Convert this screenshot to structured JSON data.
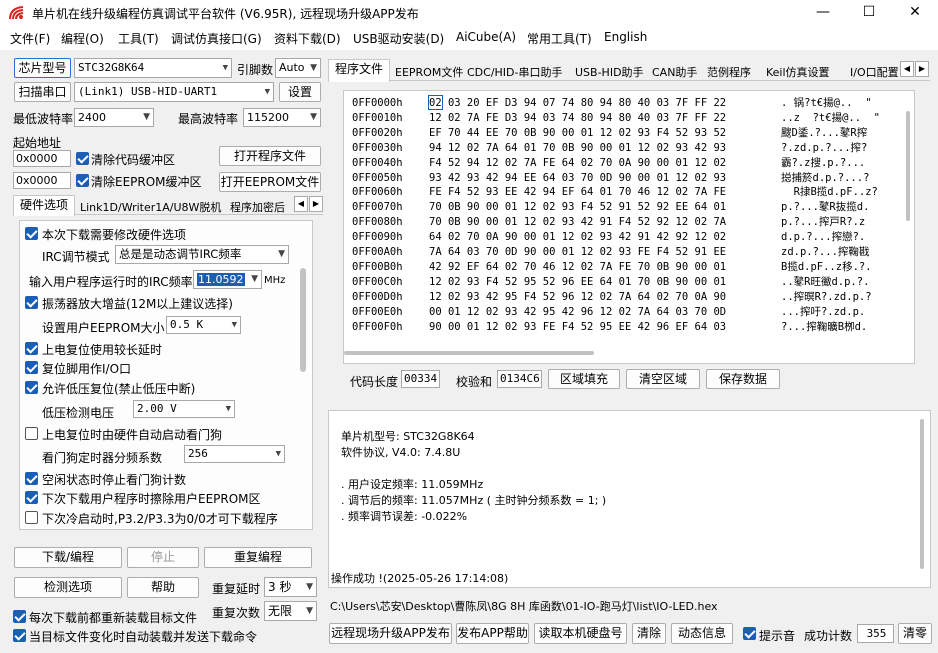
{
  "title": "单片机在线升级编程仿真调试平台软件 (V6.95R), 远程现场升级APP发布",
  "window_controls": {
    "min": "—",
    "max": "☐",
    "close": "✕"
  },
  "menu": [
    "文件(F)",
    "编程(O)",
    "工具(T)",
    "调试仿真接口(G)",
    "资料下载(D)",
    "USB驱动安装(D)",
    "AiCube(A)",
    "常用工具(T)",
    "English"
  ],
  "left": {
    "chip_btn": "芯片型号",
    "chip_value": "STC32G8K64",
    "pins_label": "引脚数",
    "pins_value": "Auto",
    "scan_btn": "扫描串口",
    "port_value": "(Link1) USB-HID-UART1",
    "settings_btn": "设置",
    "min_baud_label": "最低波特率",
    "min_baud": "2400",
    "max_baud_label": "最高波特率",
    "max_baud": "115200",
    "start_addr_label": "起始地址",
    "addr1": "0x0000",
    "clear_code": "清除代码缓冲区",
    "open_prog_btn": "打开程序文件",
    "addr2": "0x0000",
    "clear_eeprom": "清除EEPROM缓冲区",
    "open_eeprom_btn": "打开EEPROM文件",
    "tabs": [
      "硬件选项",
      "Link1D/Writer1A/U8W脱机",
      "程序加密后"
    ],
    "opt_modify": "本次下载需要修改硬件选项",
    "irc_mode_label": "IRC调节模式",
    "irc_mode": "总是是动态调节IRC频率",
    "irc_freq_label": "输入用户程序运行时的IRC频率",
    "irc_freq": "11.0592",
    "mhz": "MHz",
    "osc": "振荡器放大增益(12M以上建议选择)",
    "eeprom_size_label": "设置用户EEPROM大小",
    "eeprom_size": "0.5 K",
    "por_delay": "上电复位使用较长延时",
    "reset_io": "复位脚用作I/O口",
    "lvr": "允许低压复位(禁止低压中断)",
    "lv_label": "低压检测电压",
    "lv_value": "2.00 V",
    "wdt": "上电复位时由硬件自动启动看门狗",
    "wdt_div_label": "看门狗定时器分频系数",
    "wdt_div": "256",
    "idle_wdt": "空闲状态时停止看门狗计数",
    "erase_eeprom": "下次下载用户程序时擦除用户EEPROM区",
    "p32": "下次冷启动时,P3.2/P3.3为0/0才可下载程序",
    "download_btn": "下载/编程",
    "stop_btn": "停止",
    "reprogram_btn": "重复编程",
    "detect_btn": "检测选项",
    "help_btn": "帮助",
    "repeat_delay_label": "重复延时",
    "repeat_delay": "3 秒",
    "reload_cb": "每次下载前都重新装载目标文件",
    "repeat_count_label": "重复次数",
    "repeat_count": "无限",
    "autoload_cb": "当目标文件变化时自动装载并发送下载命令"
  },
  "right": {
    "tabs": [
      "程序文件",
      "EEPROM文件",
      "CDC/HID-串口助手",
      "USB-HID助手",
      "CAN助手",
      "范例程序",
      "Keil仿真设置",
      "I/O口配置"
    ],
    "hex_addrs": [
      "0FF0000h",
      "0FF0010h",
      "0FF0020h",
      "0FF0030h",
      "0FF0040h",
      "0FF0050h",
      "0FF0060h",
      "0FF0070h",
      "0FF0080h",
      "0FF0090h",
      "0FF00A0h",
      "0FF00B0h",
      "0FF00C0h",
      "0FF00D0h",
      "0FF00E0h",
      "0FF00F0h"
    ],
    "hex_bytes": [
      "02 03 20 EF D3 94 07 74 80 94 80 40 03 7F FF 22",
      "12 02 7A FE D3 94 03 74 80 94 80 40 03 7F FF 22",
      "EF 70 44 EE 70 0B 90 00 01 12 02 93 F4 52 93 52",
      "94 12 02 7A 64 01 70 0B 90 00 01 12 02 93 42 93",
      "F4 52 94 12 02 7A FE 64 02 70 0A 90 00 01 12 02",
      "93 42 93 42 94 EE 64 03 70 0D 90 00 01 12 02 93",
      "FE F4 52 93 EE 42 94 EF 64 01 70 46 12 02 7A FE",
      "70 0B 90 00 01 12 02 93 F4 52 91 52 92 EE 64 01",
      "70 0B 90 00 01 12 02 93 42 91 F4 52 92 12 02 7A",
      "64 02 70 0A 90 00 01 12 02 93 42 91 42 92 12 02",
      "7A 64 03 70 0D 90 00 01 12 02 93 FE F4 52 91 EE",
      "42 92 EF 64 02 70 46 12 02 7A FE 70 0B 90 00 01",
      "12 02 93 F4 52 95 52 96 EE 64 01 70 0B 90 00 01",
      "12 02 93 42 95 F4 52 96 12 02 7A 64 02 70 0A 90",
      "00 01 12 02 93 42 95 42 96 12 02 7A 64 03 70 0D",
      "90 00 01 12 02 93 FE F4 52 95 EE 42 96 EF 64 03"
    ],
    "hex_ascii": [
      ". 锅?t€揚@..  \"",
      "..z  ?t€揚@..  \"",
      "颼D鋈.?...鼕R搾",
      "?.zd.p.?...搾?",
      "霸?.z搜.p.?...",
      "搃捕箊d.p.?...?",
      "  R捸B揽d.pF..z?",
      "p.?...鼕R抜揽d.",
      "p.?...搾戸R?.z",
      "d.p.?...搾戀?.",
      "zd.p.?...搾鞠戡",
      "B揽d.pF..z移.?.",
      "..鼕R旺鰴d.p.?.",
      "..搾暝R?.zd.p.?",
      "...搾吁?.zd.p.",
      "?...搾鞠曠B栁d."
    ],
    "code_len_label": "代码长度",
    "code_len": "00334",
    "checksum_label": "校验和",
    "checksum": "0134C6",
    "fill_btn": "区域填充",
    "clear_area_btn": "清空区域",
    "save_btn": "保存数据",
    "log": [
      "单片机型号: STC32G8K64",
      "软件协议, V4.0: 7.4.8U",
      "",
      ". 用户设定频率: 11.059MHz",
      ". 调节后的频率: 11.057MHz ( 主时钟分频系数 = 1; )",
      ". 频率调节误差: -0.022%",
      "",
      "",
      "",
      "操作成功 !(2025-05-26 17:14:08)"
    ],
    "path": "C:\\Users\\芯安\\Desktop\\曹陈凤\\8G 8H 库函数\\01-IO-跑马灯\\list\\IO-LED.hex",
    "publish_btn": "远程现场升级APP发布",
    "publish_help_btn": "发布APP帮助",
    "read_disk_btn": "读取本机硬盘号",
    "clear_btn": "清除",
    "dynamic_btn": "动态信息",
    "beep": "提示音",
    "success_label": "成功计数",
    "success_count": "355",
    "clear_count_btn": "清零"
  }
}
